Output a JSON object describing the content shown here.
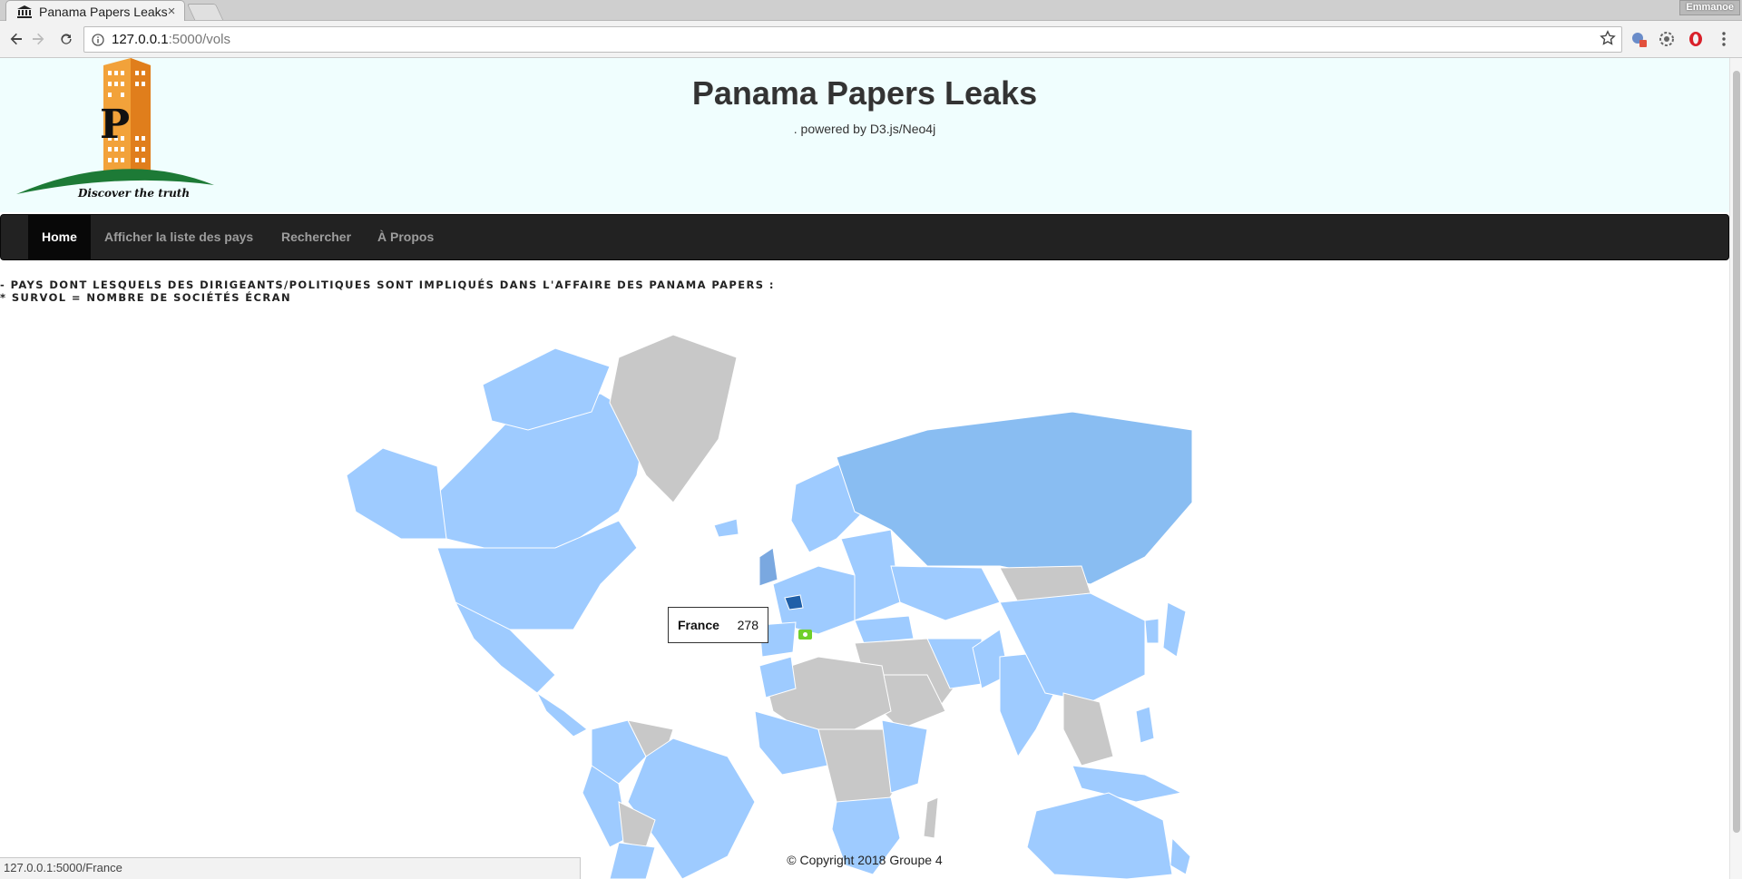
{
  "browser": {
    "tab_title": "Panama Papers Leaks",
    "tab_close": "×",
    "profile_name": "Emmanoe",
    "url_host": "127.0.0.1",
    "url_path": ":5000/vols",
    "status_url": "127.0.0.1:5000/France"
  },
  "header": {
    "title": "Panama Papers Leaks",
    "subtitle": ". powered by D3.js/Neo4j",
    "logo_tagline": "Discover the truth",
    "logo_letters": "P"
  },
  "nav": {
    "items": [
      {
        "label": "Home",
        "active": true
      },
      {
        "label": "Afficher la liste des pays",
        "active": false
      },
      {
        "label": "Rechercher",
        "active": false
      },
      {
        "label": "À Propos",
        "active": false
      }
    ]
  },
  "intro": {
    "line1": "- PAYS DONT LESQUELS DES DIRIGEANTS/POLITIQUES SONT IMPLIQUÉS DANS L'AFFAIRE DES PANAMA PAPERS :",
    "line2": "* SURVOL = NOMBRE DE SOCIÉTÉS ÉCRAN"
  },
  "map": {
    "colors": {
      "implicated": "#9ecbff",
      "implicated_dark": "#89bdf2",
      "not_implicated": "#c8c8c8",
      "hovered": "#1f5fa8"
    },
    "tooltip": {
      "country": "France",
      "count": "278"
    }
  },
  "footer": {
    "copyright": "© Copyright 2018 Groupe 4"
  }
}
